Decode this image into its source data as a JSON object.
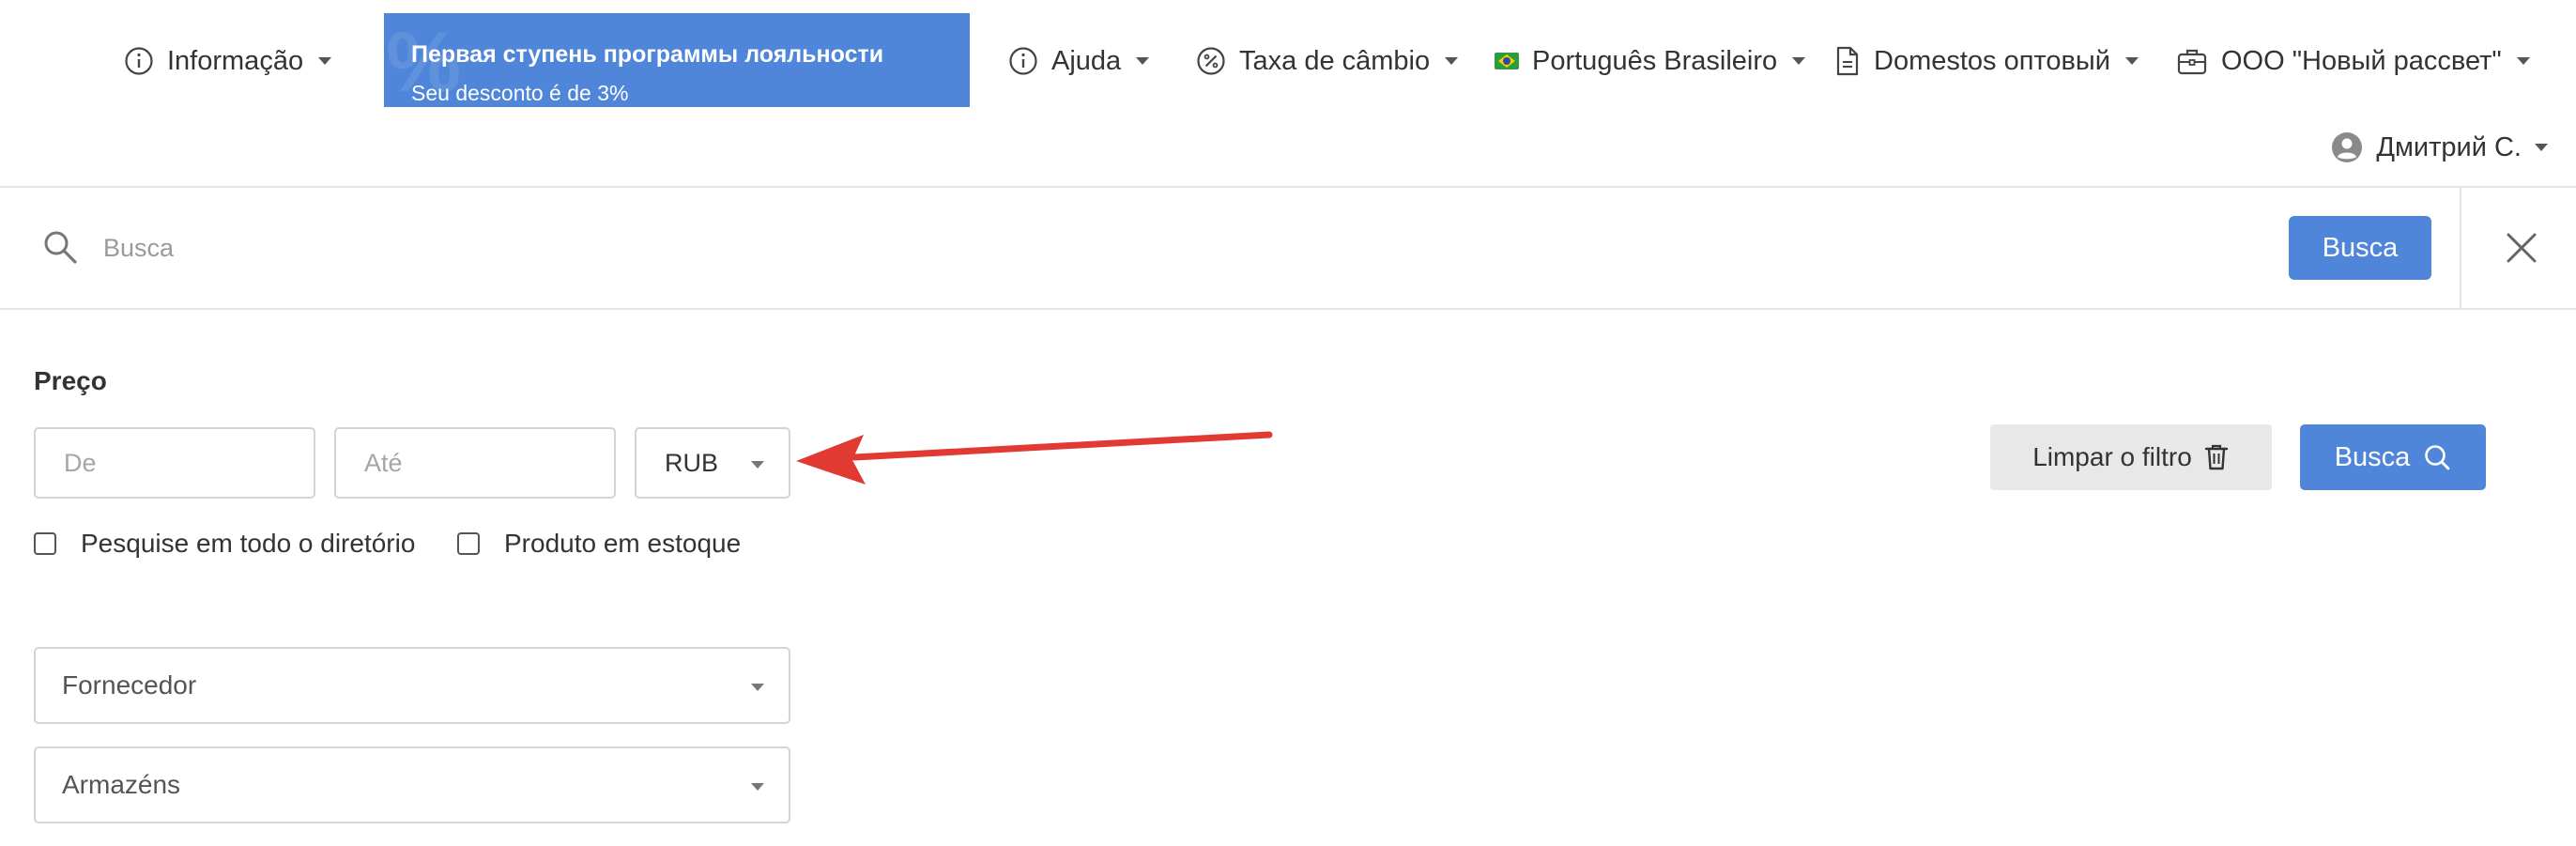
{
  "topbar": {
    "info_label": "Informação",
    "loyalty": {
      "title": "Первая ступень программы лояльности",
      "subtitle": "Seu desconto é de 3%",
      "bg_mark": "%"
    },
    "help_label": "Ajuda",
    "exchange_label": "Taxa de câmbio",
    "language_label": "Português Brasileiro",
    "document_label": "Domestos оптовый",
    "company_label": "ООО \"Новый рассвет\"",
    "user_label": "Дмитрий С."
  },
  "search": {
    "placeholder": "Busca",
    "button_label": "Busca"
  },
  "filters": {
    "price_label": "Preço",
    "from_placeholder": "De",
    "to_placeholder": "Até",
    "currency_value": "RUB",
    "checkbox_catalog": "Pesquise em todo o diretório",
    "checkbox_in_stock": "Produto em estoque",
    "clear_label": "Limpar o filtro",
    "search_label": "Busca",
    "supplier_placeholder": "Fornecedor",
    "warehouse_placeholder": "Armazéns"
  },
  "colors": {
    "accent": "#4f86d9",
    "annotation_arrow": "#e03a32"
  },
  "icons": {
    "info": "info-circle-icon",
    "help": "info-circle-icon",
    "exchange": "percent-icon",
    "language": "brazil-flag-icon",
    "document": "document-icon",
    "company": "briefcase-icon",
    "user": "user-avatar-icon",
    "search": "search-icon",
    "close": "close-icon",
    "trash": "trash-icon"
  }
}
